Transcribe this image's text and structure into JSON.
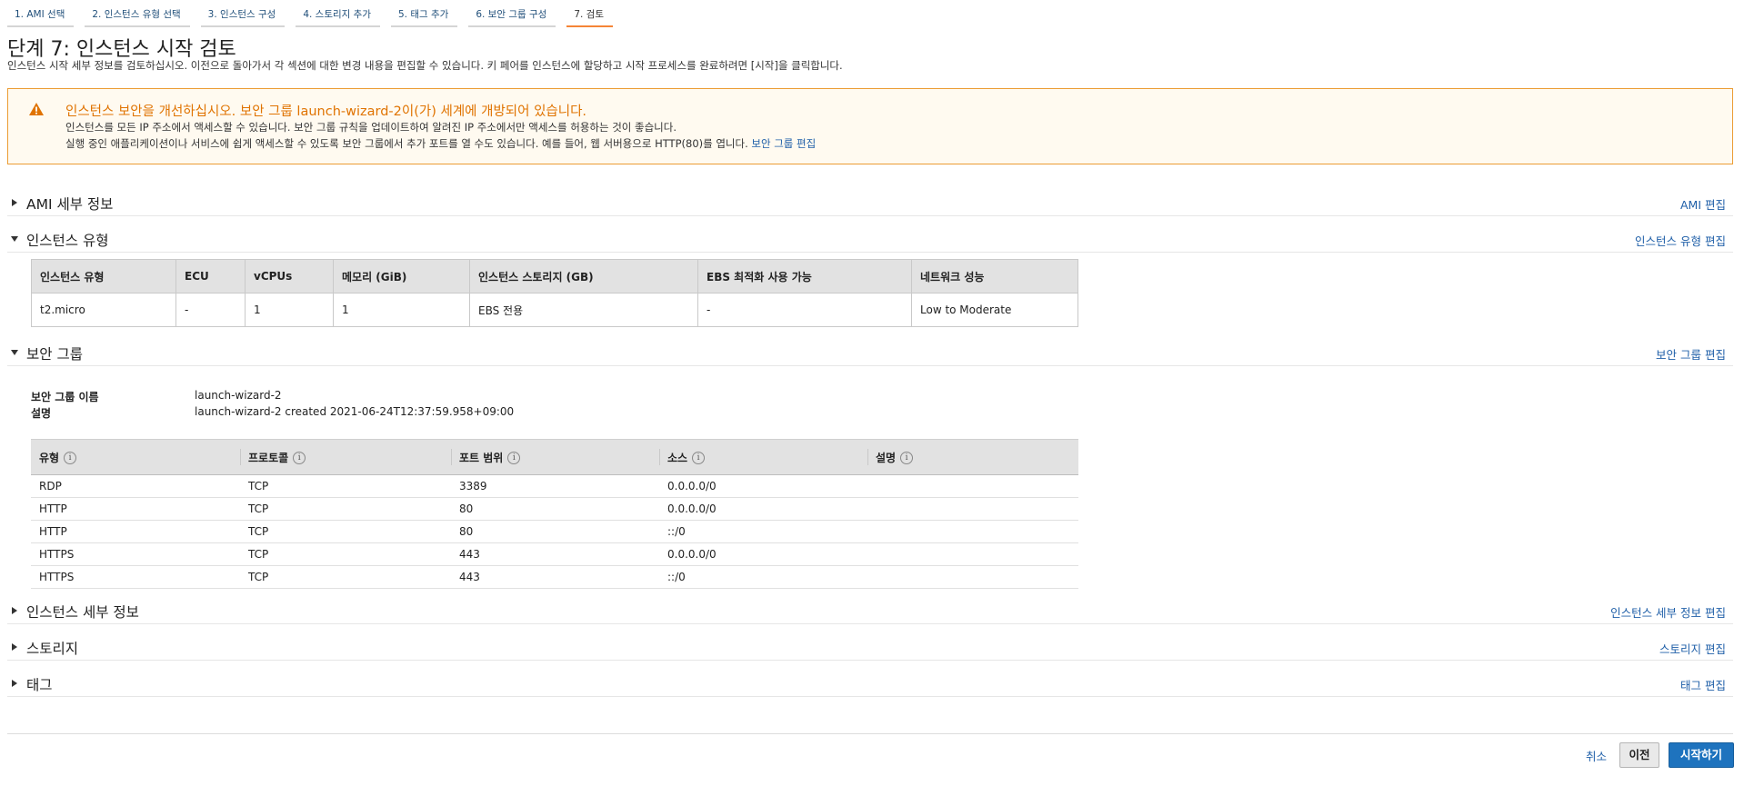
{
  "wizard": {
    "tabs": [
      "1. AMI 선택",
      "2. 인스턴스 유형 선택",
      "3. 인스턴스 구성",
      "4. 스토리지 추가",
      "5. 태그 추가",
      "6. 보안 그룹 구성",
      "7. 검토"
    ]
  },
  "header": {
    "title": "단계 7: 인스턴스 시작 검토",
    "description": "인스턴스 시작 세부 정보를 검토하십시오. 이전으로 돌아가서 각 섹션에 대한 변경 내용을 편집할 수 있습니다. 키 페어를 인스턴스에 할당하고 시작 프로세스를 완료하려면 [시작]을 클릭합니다."
  },
  "alert": {
    "title": "인스턴스 보안을 개선하십시오. 보안 그룹 launch-wizard-2이(가) 세계에 개방되어 있습니다.",
    "line1": "인스턴스를 모든 IP 주소에서 액세스할 수 있습니다. 보안 그룹 규칙을 업데이트하여 알려진 IP 주소에서만 액세스를 허용하는 것이 좋습니다.",
    "line2": "실행 중인 애플리케이션이나 서비스에 쉽게 액세스할 수 있도록 보안 그룹에서 추가 포트를 열 수도 있습니다. 예를 들어, 웹 서버용으로 HTTP(80)를 엽니다.",
    "link": "보안 그룹 편집",
    "color": "#e07300"
  },
  "sections": {
    "ami": {
      "title": "AMI 세부 정보",
      "edit": "AMI 편집"
    },
    "instance_type": {
      "title": "인스턴스 유형",
      "edit": "인스턴스 유형 편집"
    },
    "security_group": {
      "title": "보안 그룹",
      "edit": "보안 그룹 편집"
    },
    "instance_details": {
      "title": "인스턴스 세부 정보",
      "edit": "인스턴스 세부 정보 편집"
    },
    "storage": {
      "title": "스토리지",
      "edit": "스토리지 편집"
    },
    "tags": {
      "title": "태그",
      "edit": "태그 편집"
    }
  },
  "instance_table": {
    "headers": [
      "인스턴스 유형",
      "ECU",
      "vCPUs",
      "메모리 (GiB)",
      "인스턴스 스토리지 (GB)",
      "EBS 최적화 사용 가능",
      "네트워크 성능"
    ],
    "row": [
      "t2.micro",
      "-",
      "1",
      "1",
      "EBS 전용",
      "-",
      "Low to Moderate"
    ]
  },
  "security_group": {
    "name_label": "보안 그룹 이름",
    "name_value": "launch-wizard-2",
    "desc_label": "설명",
    "desc_value": "launch-wizard-2 created 2021-06-24T12:37:59.958+09:00",
    "rule_headers": [
      "유형",
      "프로토콜",
      "포트 범위",
      "소스",
      "설명"
    ],
    "info_glyph": "i",
    "rules": [
      [
        "RDP",
        "TCP",
        "3389",
        "0.0.0.0/0",
        ""
      ],
      [
        "HTTP",
        "TCP",
        "80",
        "0.0.0.0/0",
        ""
      ],
      [
        "HTTP",
        "TCP",
        "80",
        "::/0",
        ""
      ],
      [
        "HTTPS",
        "TCP",
        "443",
        "0.0.0.0/0",
        ""
      ],
      [
        "HTTPS",
        "TCP",
        "443",
        "::/0",
        ""
      ]
    ]
  },
  "footer": {
    "cancel": "취소",
    "previous": "이전",
    "launch": "시작하기",
    "launch_color": "#1e73be"
  }
}
